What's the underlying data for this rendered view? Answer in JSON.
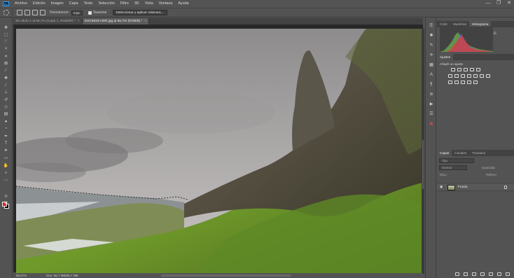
{
  "menu": {
    "logo": "Ps",
    "items": [
      "Archivo",
      "Edición",
      "Imagen",
      "Capa",
      "Texto",
      "Selección",
      "Filtro",
      "3D",
      "Vista",
      "Ventana",
      "Ayuda"
    ],
    "window_controls": [
      "—",
      "❐",
      "✕"
    ]
  },
  "options_bar": {
    "feather_label": "Desvanecer:",
    "feather_value": "0 px",
    "smooth_label": "Suavizar",
    "select_mask_button": "Seleccionar y aplicar máscara..."
  },
  "document_tabs": [
    {
      "label": "Sin título-1 al 66,7% (Capa 1, RGB/8#) *",
      "close": "×",
      "active": false
    },
    {
      "label": "DSC6933-HDR.jpg al 66,7% (RGB/8) *",
      "close": "×",
      "active": true
    }
  ],
  "status_bar": {
    "zoom": "66,67%",
    "doc": "Doc: 66,7 MB/66,7 MB"
  },
  "panels": {
    "top_tabs": [
      "Color",
      "Muestras",
      "Histograma"
    ],
    "active_top_tab": "Histograma",
    "adjust_tabs": [
      "Ajustes"
    ],
    "adjust_title": "Añadir un ajuste",
    "layers_tabs": [
      "Capas",
      "Canales",
      "Trazados"
    ],
    "search_placeholder": "Tipo",
    "blend_mode": "Normal",
    "opacity_label": "Opacidad:",
    "lock_label": "Bloq.:",
    "fill_label": "Relleno:",
    "layer": {
      "name": "Fondo"
    }
  },
  "colors": {
    "foreground": "#e01b1b",
    "background": "#000000",
    "histogram_accent": "#e63737"
  },
  "icons": {
    "tools": [
      "move-icon",
      "marquee-icon",
      "lasso-icon",
      "magic-wand-icon",
      "crop-icon",
      "frame-icon",
      "eyedropper-icon",
      "healing-brush-icon",
      "brush-icon",
      "stamp-icon",
      "history-brush-icon",
      "eraser-icon",
      "gradient-icon",
      "blur-icon",
      "dodge-icon",
      "pen-icon",
      "type-icon",
      "path-selection-icon",
      "rectangle-icon",
      "hand-icon",
      "zoom-icon"
    ]
  }
}
